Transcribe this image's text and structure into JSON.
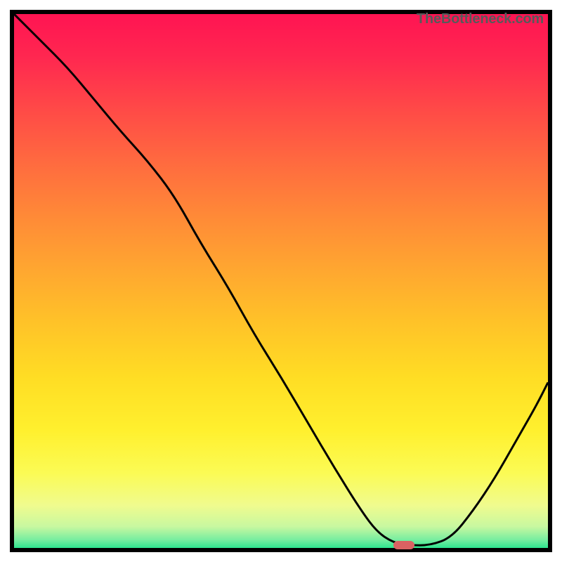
{
  "watermark": {
    "text": "TheBottleneck.com"
  },
  "colors": {
    "frame": "#000000",
    "curve": "#000000",
    "trough_marker": "#da6262"
  },
  "chart_data": {
    "type": "line",
    "title": "",
    "xlabel": "",
    "ylabel": "",
    "xlim": [
      0,
      100
    ],
    "ylim": [
      0,
      100
    ],
    "x": [
      0,
      5,
      10,
      15,
      20,
      25,
      30,
      35,
      40,
      45,
      50,
      55,
      60,
      65,
      68,
      71,
      74,
      78,
      82,
      86,
      90,
      94,
      98,
      100
    ],
    "values": [
      100,
      95,
      90,
      84,
      78,
      72.5,
      66,
      57,
      49,
      40,
      32,
      23.5,
      15,
      7,
      3,
      1,
      0.5,
      0.5,
      2,
      7,
      13,
      20,
      27,
      31
    ],
    "trough": {
      "x": 73,
      "y": 0.5
    },
    "gradient_stops": [
      {
        "offset": 0.0,
        "color": "#ff1452"
      },
      {
        "offset": 0.08,
        "color": "#ff2750"
      },
      {
        "offset": 0.18,
        "color": "#ff4a47"
      },
      {
        "offset": 0.28,
        "color": "#ff6b3f"
      },
      {
        "offset": 0.38,
        "color": "#ff8a37"
      },
      {
        "offset": 0.48,
        "color": "#ffa730"
      },
      {
        "offset": 0.58,
        "color": "#ffc328"
      },
      {
        "offset": 0.68,
        "color": "#ffdd24"
      },
      {
        "offset": 0.78,
        "color": "#fff02e"
      },
      {
        "offset": 0.86,
        "color": "#fbfb55"
      },
      {
        "offset": 0.92,
        "color": "#f0fb8e"
      },
      {
        "offset": 0.96,
        "color": "#c8f8a0"
      },
      {
        "offset": 0.985,
        "color": "#76eda0"
      },
      {
        "offset": 1.0,
        "color": "#2de58f"
      }
    ]
  }
}
